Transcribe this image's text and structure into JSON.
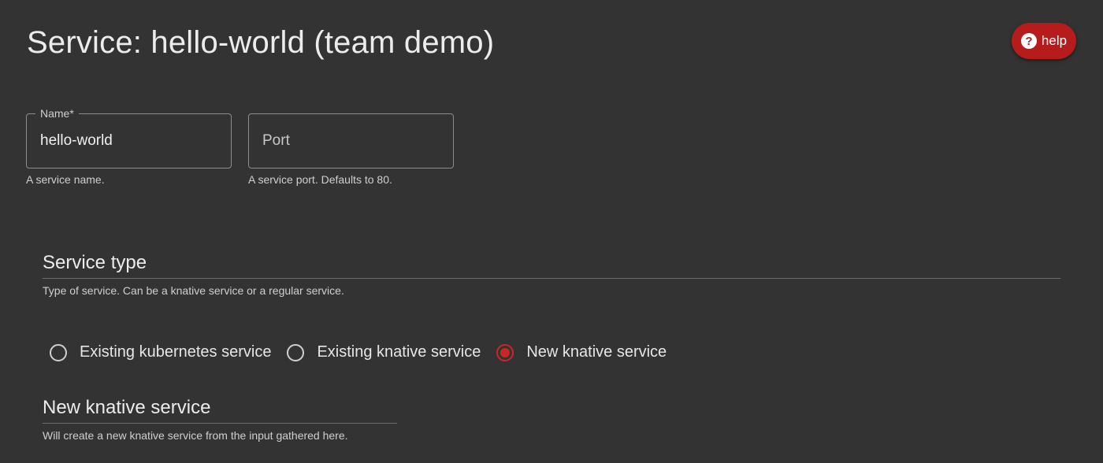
{
  "page": {
    "title": "Service: hello-world (team demo)"
  },
  "help": {
    "icon": "question-circle-icon",
    "icon_glyph": "?",
    "label": "help",
    "color": "#b71c1c"
  },
  "form": {
    "name": {
      "label": "Name",
      "required_mark": "*",
      "value": "hello-world",
      "helper": "A service name."
    },
    "port": {
      "placeholder": "Port",
      "value": "",
      "helper": "A service port. Defaults to 80."
    }
  },
  "service_type": {
    "title": "Service type",
    "description": "Type of service. Can be a knative service or a regular service.",
    "options": [
      {
        "label": "Existing kubernetes service",
        "selected": false
      },
      {
        "label": "Existing knative service",
        "selected": false
      },
      {
        "label": "New knative service",
        "selected": true
      }
    ],
    "accent_color": "#c62828"
  },
  "new_knative": {
    "title": "New knative service",
    "description": "Will create a new knative service from the input gathered here."
  }
}
